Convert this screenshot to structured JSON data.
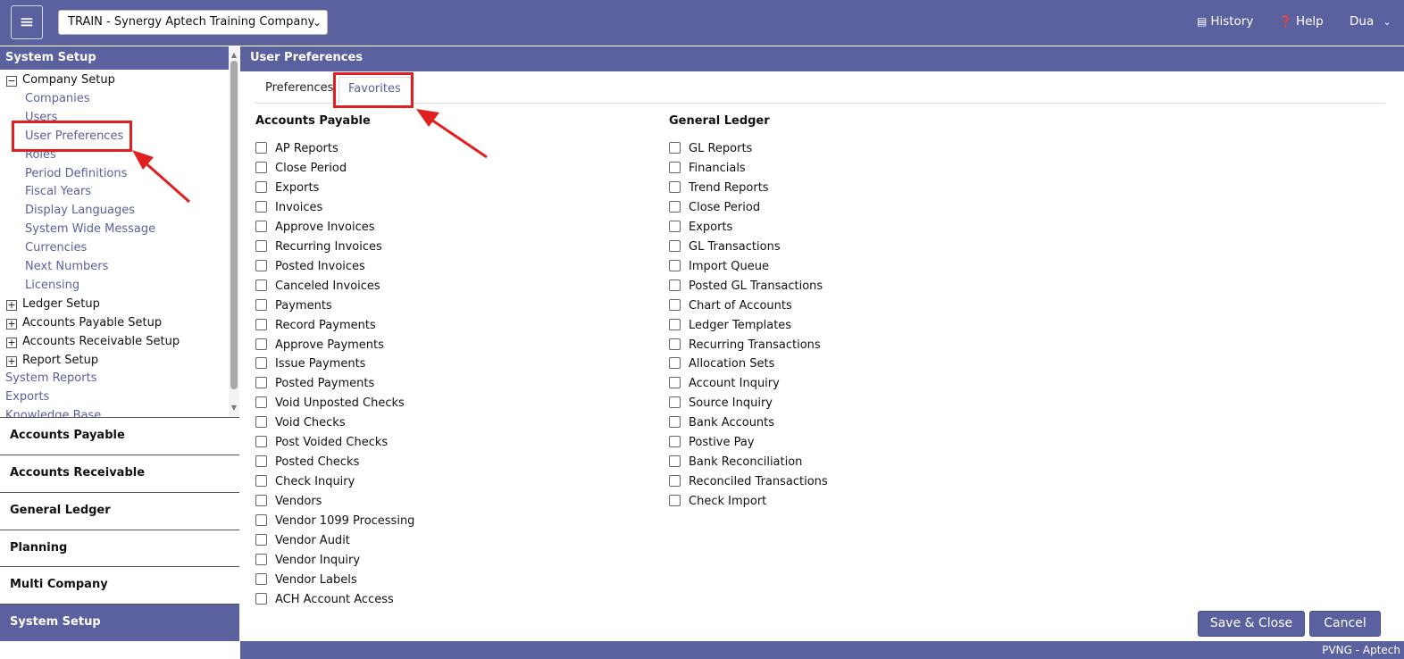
{
  "topbar": {
    "company": "TRAIN - Synergy Aptech Training Company",
    "history": "History",
    "help": "Help",
    "user": "Dua"
  },
  "sidebar": {
    "header": "System Setup",
    "tree": [
      {
        "label": "Company Setup",
        "kind": "parent",
        "toggle": "−"
      },
      {
        "label": "Companies",
        "kind": "child"
      },
      {
        "label": "Users",
        "kind": "child"
      },
      {
        "label": "User Preferences",
        "kind": "child"
      },
      {
        "label": "Roles",
        "kind": "child"
      },
      {
        "label": "Period Definitions",
        "kind": "child"
      },
      {
        "label": "Fiscal Years",
        "kind": "child"
      },
      {
        "label": "Display Languages",
        "kind": "child"
      },
      {
        "label": "System Wide Message",
        "kind": "child"
      },
      {
        "label": "Currencies",
        "kind": "child"
      },
      {
        "label": "Next Numbers",
        "kind": "child"
      },
      {
        "label": "Licensing",
        "kind": "child"
      },
      {
        "label": "Ledger Setup",
        "kind": "parent",
        "toggle": "+"
      },
      {
        "label": "Accounts Payable Setup",
        "kind": "parent",
        "toggle": "+"
      },
      {
        "label": "Accounts Receivable Setup",
        "kind": "parent",
        "toggle": "+"
      },
      {
        "label": "Report Setup",
        "kind": "parent",
        "toggle": "+"
      },
      {
        "label": "System Reports",
        "kind": "top"
      },
      {
        "label": "Exports",
        "kind": "top"
      },
      {
        "label": "Knowledge Base",
        "kind": "top"
      }
    ],
    "modules": [
      "Accounts Payable",
      "Accounts Receivable",
      "General Ledger",
      "Planning",
      "Multi Company",
      "System Setup"
    ]
  },
  "main": {
    "header": "User Preferences",
    "tabs": {
      "preferences": "Preferences",
      "favorites": "Favorites"
    },
    "ap_title": "Accounts Payable",
    "gl_title": "General Ledger",
    "ap_items": [
      "AP Reports",
      "Close Period",
      "Exports",
      "Invoices",
      "Approve Invoices",
      "Recurring Invoices",
      "Posted Invoices",
      "Canceled Invoices",
      "Payments",
      "Record Payments",
      "Approve Payments",
      "Issue Payments",
      "Posted Payments",
      "Void Unposted Checks",
      "Void Checks",
      "Post Voided Checks",
      "Posted Checks",
      "Check Inquiry",
      "Vendors",
      "Vendor 1099 Processing",
      "Vendor Audit",
      "Vendor Inquiry",
      "Vendor Labels",
      "ACH Account Access"
    ],
    "gl_items": [
      "GL Reports",
      "Financials",
      "Trend Reports",
      "Close Period",
      "Exports",
      "GL Transactions",
      "Import Queue",
      "Posted GL Transactions",
      "Chart of Accounts",
      "Ledger Templates",
      "Recurring Transactions",
      "Allocation Sets",
      "Account Inquiry",
      "Source Inquiry",
      "Bank Accounts",
      "Postive Pay",
      "Bank Reconciliation",
      "Reconciled Transactions",
      "Check Import"
    ],
    "save_label": "Save & Close",
    "cancel_label": "Cancel"
  },
  "footer": "PVNG - Aptech",
  "colors": {
    "brand": "#5a619e",
    "annotation": "#e02020"
  }
}
